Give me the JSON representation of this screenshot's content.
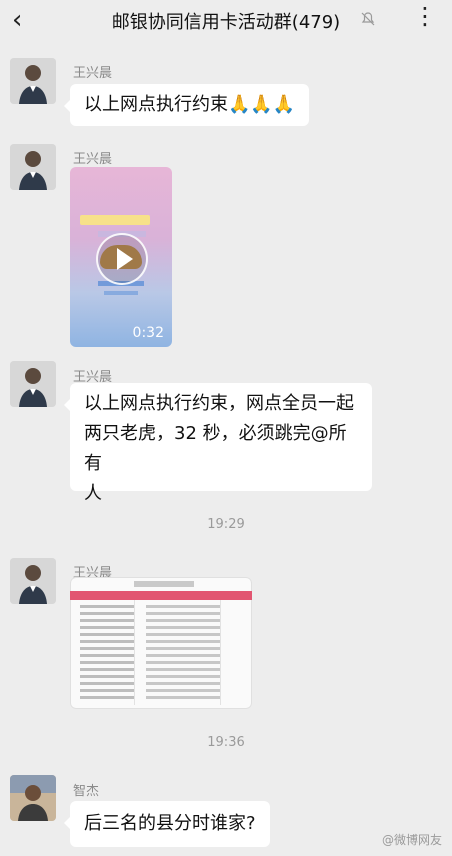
{
  "header": {
    "back_icon": "chevron-left-icon",
    "title": "邮银协同信用卡活动群(479)",
    "mute_icon": "bell-muted-icon",
    "more_icon": "more-dots-icon"
  },
  "messages": [
    {
      "sender": "王兴晨",
      "text": "以上网点执行约束🙏🙏🙏"
    },
    {
      "sender": "王兴晨",
      "video_duration": "0:32"
    },
    {
      "sender": "王兴晨",
      "lines": [
        "以上网点执行约束，网点全员一起",
        "两只老虎，32 秒，必须跳完@所有",
        "人"
      ]
    },
    {
      "sender": "王兴晨"
    },
    {
      "sender": "智杰",
      "text": "后三名的县分时谁家?"
    }
  ],
  "timestamps": [
    "19:29",
    "19:36"
  ],
  "watermark": "@微博网友"
}
